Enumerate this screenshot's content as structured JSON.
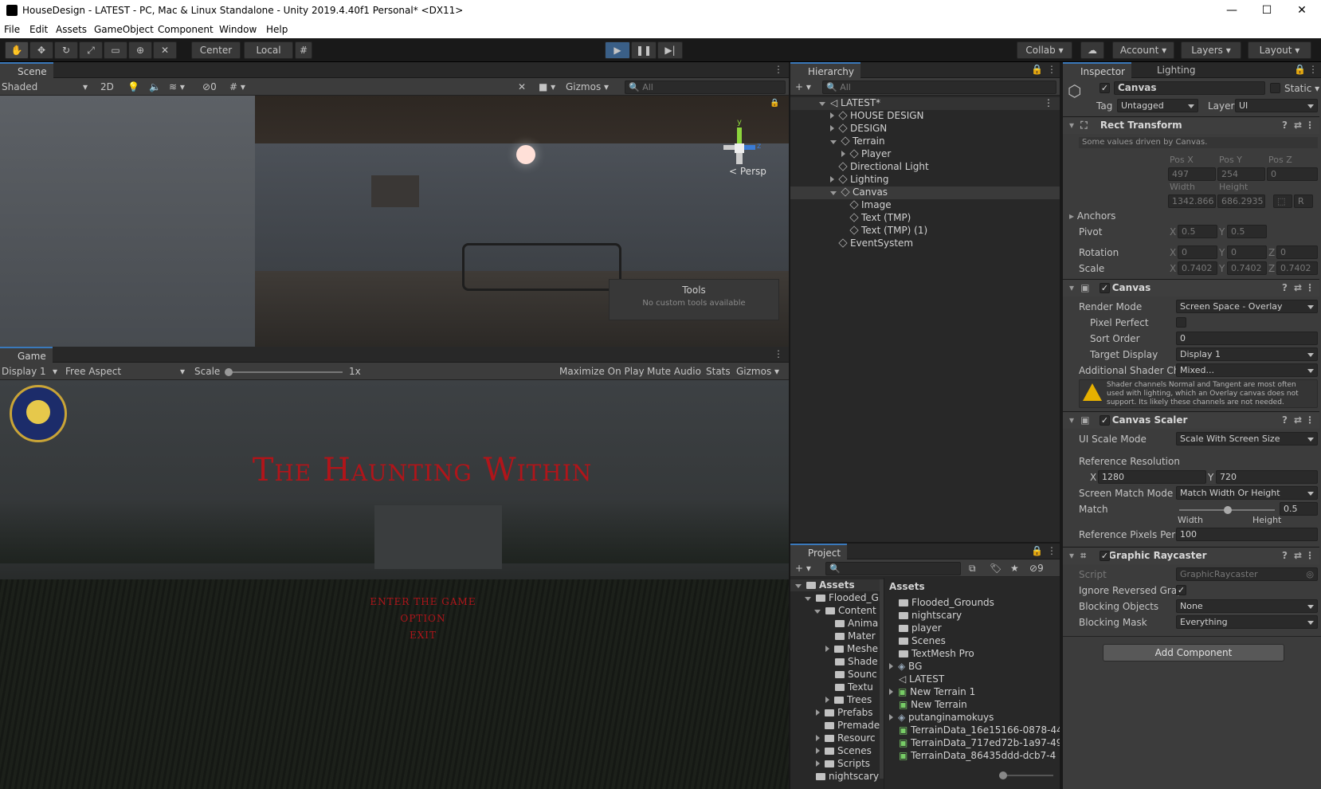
{
  "window": {
    "title": "HouseDesign - LATEST - PC, Mac & Linux Standalone - Unity 2019.4.40f1 Personal* <DX11>",
    "minimize": "—",
    "maximize": "☐",
    "close": "✕"
  },
  "menu": [
    "File",
    "Edit",
    "Assets",
    "GameObject",
    "Component",
    "Window",
    "Help"
  ],
  "toolbar": {
    "center": "Center",
    "local": "Local",
    "collab": "Collab",
    "account": "Account",
    "layers": "Layers",
    "layout": "Layout"
  },
  "scene": {
    "tab": "Scene",
    "shading": "Shaded",
    "mode2d": "2D",
    "hidden_count": "0",
    "gizmos": "Gizmos",
    "search_placeholder": "All",
    "persp": "Persp",
    "tools_title": "Tools",
    "tools_text": "No custom tools available",
    "axis_y": "y",
    "axis_z": "z"
  },
  "game": {
    "tab": "Game",
    "display": "Display 1",
    "aspect": "Free Aspect",
    "scale_label": "Scale",
    "scale_value": "1x",
    "maximize": "Maximize On Play",
    "mute": "Mute Audio",
    "stats": "Stats",
    "gizmos": "Gizmos",
    "title": "The Haunting Within",
    "menu_items": [
      "Enter the game",
      "Option",
      "Exit"
    ]
  },
  "hierarchy": {
    "tab": "Hierarchy",
    "search_placeholder": "All",
    "scene_name": "LATEST*",
    "items": [
      {
        "label": "HOUSE DESIGN",
        "arrow": "right"
      },
      {
        "label": "DESIGN",
        "arrow": "right"
      },
      {
        "label": "Terrain",
        "arrow": "down"
      },
      {
        "label": "Player",
        "arrow": "right"
      },
      {
        "label": "Directional Light",
        "arrow": ""
      },
      {
        "label": "Lighting",
        "arrow": "right"
      },
      {
        "label": "Canvas",
        "arrow": "down"
      },
      {
        "label": "Image",
        "arrow": ""
      },
      {
        "label": "Text (TMP)",
        "arrow": ""
      },
      {
        "label": "Text (TMP) (1)",
        "arrow": ""
      },
      {
        "label": "EventSystem",
        "arrow": ""
      }
    ]
  },
  "project": {
    "tab": "Project",
    "hidden_count": "9",
    "tree_root": "Assets",
    "assets_header": "Assets",
    "tree": [
      "Flooded_Gr",
      "Content",
      "Anima",
      "Mater",
      "Meshe",
      "Shade",
      "Sounc",
      "Textu",
      "Trees",
      "Prefabs",
      "Premade",
      "Resourc",
      "Scenes",
      "Scripts",
      "nightscary"
    ],
    "assets": [
      {
        "label": "Flooded_Grounds",
        "kind": "folder"
      },
      {
        "label": "nightscary",
        "kind": "folder"
      },
      {
        "label": "player",
        "kind": "folder"
      },
      {
        "label": "Scenes",
        "kind": "folder"
      },
      {
        "label": "TextMesh Pro",
        "kind": "folder"
      },
      {
        "label": "BG",
        "kind": "prefab"
      },
      {
        "label": "LATEST",
        "kind": "scene"
      },
      {
        "label": "New Terrain 1",
        "kind": "terrain"
      },
      {
        "label": "New Terrain",
        "kind": "terrain"
      },
      {
        "label": "putanginamokuys",
        "kind": "prefab"
      },
      {
        "label": "TerrainData_16e15166-0878-44",
        "kind": "terrain"
      },
      {
        "label": "TerrainData_717ed72b-1a97-49",
        "kind": "terrain"
      },
      {
        "label": "TerrainData_86435ddd-dcb7-4",
        "kind": "terrain"
      }
    ]
  },
  "inspector": {
    "tab": "Inspector",
    "tab2": "Lighting",
    "object_name": "Canvas",
    "static": "Static",
    "tag_label": "Tag",
    "tag_value": "Untagged",
    "layer_label": "Layer",
    "layer_value": "UI",
    "rect": {
      "title": "Rect Transform",
      "note": "Some values driven by Canvas.",
      "posx_l": "Pos X",
      "posy_l": "Pos Y",
      "posz_l": "Pos Z",
      "posx": "497",
      "posy": "254",
      "posz": "0",
      "width_l": "Width",
      "height_l": "Height",
      "width": "1342.866",
      "height": "686.2935",
      "r": "R",
      "anchors": "Anchors",
      "pivot": "Pivot",
      "pivot_x": "0.5",
      "pivot_y": "0.5",
      "rotation": "Rotation",
      "rot_x": "0",
      "rot_y": "0",
      "rot_z": "0",
      "scale": "Scale",
      "scale_x": "0.7402",
      "scale_y": "0.7402",
      "scale_z": "0.7402",
      "x": "X",
      "y": "Y",
      "z": "Z"
    },
    "canvas": {
      "title": "Canvas",
      "render_mode_l": "Render Mode",
      "render_mode": "Screen Space - Overlay",
      "pixel_perfect": "Pixel Perfect",
      "sort_order_l": "Sort Order",
      "sort_order": "0",
      "target_display_l": "Target Display",
      "target_display": "Display 1",
      "shader_ch_l": "Additional Shader Ch",
      "shader_ch": "Mixed...",
      "warning": "Shader channels Normal and Tangent are most often used with lighting, which an Overlay canvas does not support. Its likely these channels are not needed."
    },
    "scaler": {
      "title": "Canvas Scaler",
      "ui_scale_l": "UI Scale Mode",
      "ui_scale": "Scale With Screen Size",
      "ref_res": "Reference Resolution",
      "x": "X",
      "y": "Y",
      "ref_x": "1280",
      "ref_y": "720",
      "match_mode_l": "Screen Match Mode",
      "match_mode": "Match Width Or Height",
      "match_l": "Match",
      "match": "0.5",
      "width_l": "Width",
      "height_l": "Height",
      "ppu_l": "Reference Pixels Per",
      "ppu": "100"
    },
    "raycaster": {
      "title": "Graphic Raycaster",
      "script_l": "Script",
      "script": "GraphicRaycaster",
      "ignore_l": "Ignore Reversed Grap",
      "blocking_l": "Blocking Objects",
      "blocking": "None",
      "mask_l": "Blocking Mask",
      "mask": "Everything"
    },
    "add_component": "Add Component"
  }
}
